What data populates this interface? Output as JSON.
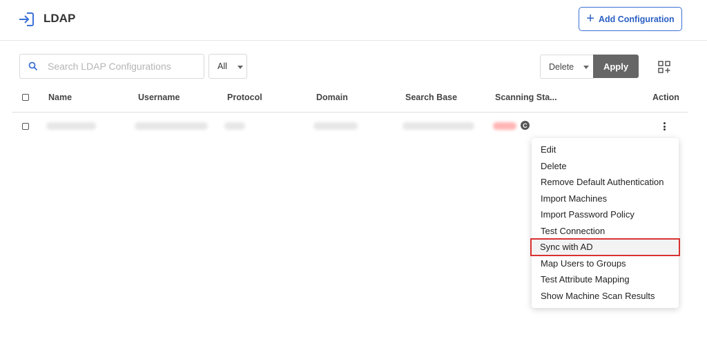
{
  "header": {
    "title": "LDAP",
    "add_button_label": "Add Configuration"
  },
  "toolbar": {
    "search_placeholder": "Search LDAP Configurations",
    "filter_value": "All",
    "bulk_action_value": "Delete",
    "apply_label": "Apply"
  },
  "table": {
    "columns": [
      "Name",
      "Username",
      "Protocol",
      "Domain",
      "Search Base",
      "Scanning Sta...",
      "Action"
    ],
    "rows": [
      {
        "status_icon": "C"
      }
    ]
  },
  "menu": {
    "items": [
      "Edit",
      "Delete",
      "Remove Default Authentication",
      "Import Machines",
      "Import Password Policy",
      "Test Connection",
      "Sync with AD",
      "Map Users to Groups",
      "Test Attribute Mapping",
      "Show Machine Scan Results"
    ],
    "highlighted": "Sync with AD"
  },
  "colors": {
    "accent": "#3a6fd6",
    "apply_bg": "#666666",
    "highlight_border": "#d93030"
  }
}
